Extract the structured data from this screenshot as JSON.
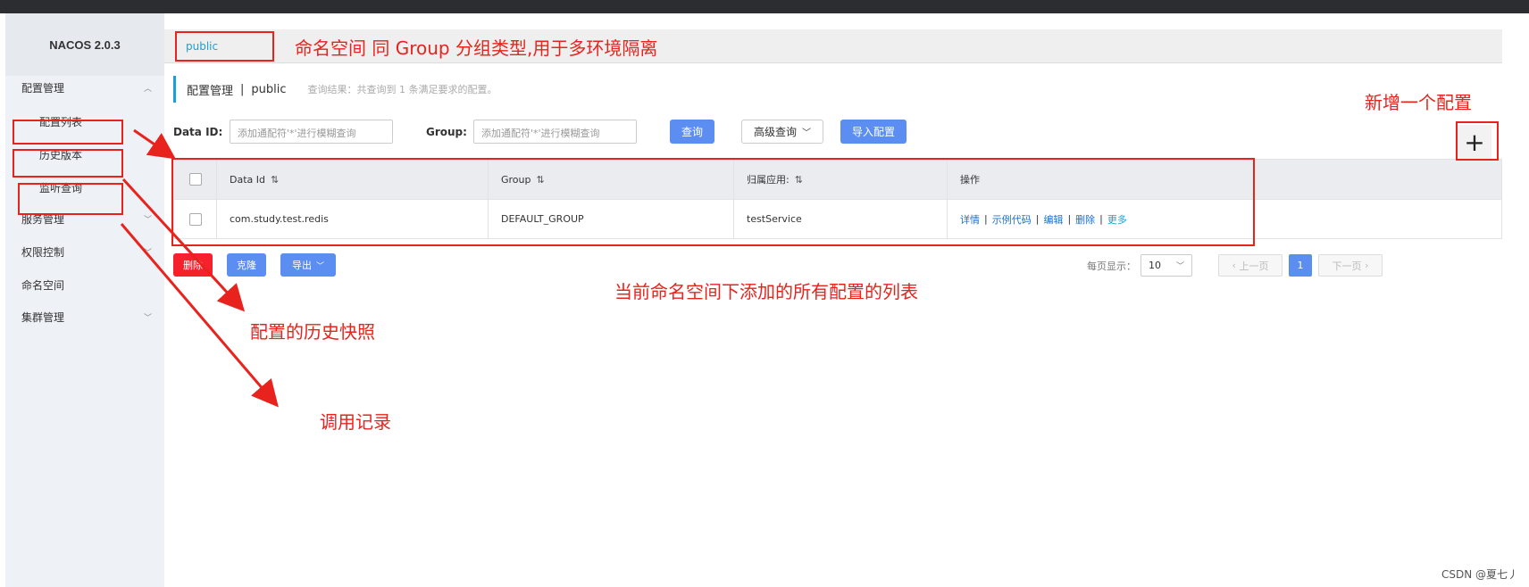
{
  "app": {
    "title": "NACOS 2.0.3"
  },
  "sidebar": {
    "items": [
      {
        "label": "配置管理",
        "chevron": "^"
      },
      {
        "label": "服务管理",
        "chevron": "v"
      },
      {
        "label": "权限控制",
        "chevron": "v"
      },
      {
        "label": "命名空间",
        "chevron": ""
      },
      {
        "label": "集群管理",
        "chevron": "v"
      }
    ],
    "subitems": [
      "配置列表",
      "历史版本",
      "监听查询"
    ]
  },
  "namespace": {
    "current": "public"
  },
  "breadcrumb": {
    "section": "配置管理",
    "separator": "|",
    "namespace": "public",
    "result_hint": "查询结果：共查询到 1 条满足要求的配置。"
  },
  "filters": {
    "data_id_label": "Data ID:",
    "data_id_placeholder": "添加通配符'*'进行模糊查询",
    "group_label": "Group:",
    "group_placeholder": "添加通配符'*'进行模糊查询",
    "search_button": "查询",
    "advanced_button": "高级查询",
    "import_button": "导入配置"
  },
  "add_button": {
    "icon": "plus-icon",
    "glyph": "+"
  },
  "table": {
    "columns": [
      "Data Id",
      "Group",
      "归属应用:",
      "操作"
    ],
    "rows": [
      {
        "data_id": "com.study.test.redis",
        "group": "DEFAULT_GROUP",
        "app": "testService",
        "ops": [
          "详情",
          "示例代码",
          "编辑",
          "删除",
          "更多"
        ]
      }
    ]
  },
  "actions": {
    "delete_button": "删除",
    "clone_button": "克隆",
    "export_button": "导出"
  },
  "pager": {
    "page_size_label": "每页显示：",
    "page_size": "10",
    "prev": "上一页",
    "current_page": "1",
    "next": "下一页"
  },
  "annotations": {
    "namespace_note": "命名空间 同 Group 分组类型,用于多环境隔离",
    "add_note": "新增一个配置",
    "list_note": "当前命名空间下添加的所有配置的列表",
    "history_note": "配置的历史快照",
    "listen_note": "调用记录"
  },
  "watermark": "CSDN @夏七丿",
  "colors": {
    "accent": "#5b8ef0",
    "danger": "#f5222d",
    "annotation_red": "#e8231d",
    "link": "#1a6fd1"
  }
}
